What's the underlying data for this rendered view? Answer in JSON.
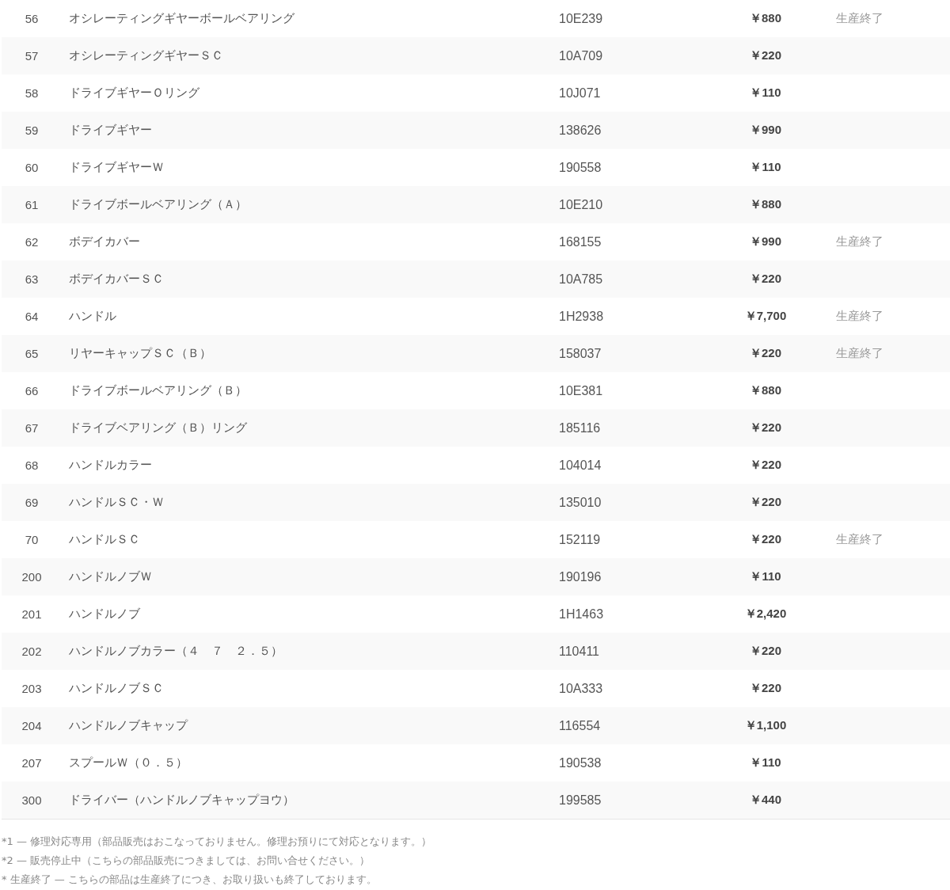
{
  "parts_table": {
    "rows": [
      {
        "no": "56",
        "name": "オシレーティングギヤーボールベアリング",
        "code": "10E239",
        "price": "￥880",
        "status": "生産終了"
      },
      {
        "no": "57",
        "name": "オシレーティングギヤーＳＣ",
        "code": "10A709",
        "price": "￥220"
      },
      {
        "no": "58",
        "name": "ドライブギヤーＯリング",
        "code": "10J071",
        "price": "￥110"
      },
      {
        "no": "59",
        "name": "ドライブギヤー",
        "code": "138626",
        "price": "￥990"
      },
      {
        "no": "60",
        "name": "ドライブギヤーＷ",
        "code": "190558",
        "price": "￥110"
      },
      {
        "no": "61",
        "name": "ドライブボールベアリング（Ａ）",
        "code": "10E210",
        "price": "￥880"
      },
      {
        "no": "62",
        "name": "ボデイカバー",
        "code": "168155",
        "price": "￥990",
        "status": "生産終了"
      },
      {
        "no": "63",
        "name": "ボデイカバーＳＣ",
        "code": "10A785",
        "price": "￥220"
      },
      {
        "no": "64",
        "name": "ハンドル",
        "code": "1H2938",
        "price": "￥7,700",
        "status": "生産終了"
      },
      {
        "no": "65",
        "name": "リヤーキャップＳＣ（Ｂ）",
        "code": "158037",
        "price": "￥220",
        "status": "生産終了"
      },
      {
        "no": "66",
        "name": "ドライブボールベアリング（Ｂ）",
        "code": "10E381",
        "price": "￥880"
      },
      {
        "no": "67",
        "name": "ドライブベアリング（Ｂ）リング",
        "code": "185116",
        "price": "￥220"
      },
      {
        "no": "68",
        "name": "ハンドルカラー",
        "code": "104014",
        "price": "￥220"
      },
      {
        "no": "69",
        "name": "ハンドルＳＣ・Ｗ",
        "code": "135010",
        "price": "￥220"
      },
      {
        "no": "70",
        "name": "ハンドルＳＣ",
        "code": "152119",
        "price": "￥220",
        "status": "生産終了"
      },
      {
        "no": "200",
        "name": "ハンドルノブＷ",
        "code": "190196",
        "price": "￥110"
      },
      {
        "no": "201",
        "name": "ハンドルノブ",
        "code": "1H1463",
        "price": "￥2,420"
      },
      {
        "no": "202",
        "name": "ハンドルノブカラー（４　７　２．５）",
        "code": "110411",
        "price": "￥220"
      },
      {
        "no": "203",
        "name": "ハンドルノブＳＣ",
        "code": "10A333",
        "price": "￥220"
      },
      {
        "no": "204",
        "name": "ハンドルノブキャップ",
        "code": "116554",
        "price": "￥1,100"
      },
      {
        "no": "207",
        "name": "スプールＷ（０．５）",
        "code": "190538",
        "price": "￥110"
      },
      {
        "no": "300",
        "name": "ドライバー（ハンドルノブキャップヨウ）",
        "code": "199585",
        "price": "￥440"
      }
    ]
  },
  "notes": [
    "*1 — 修理対応専用（部品販売はおこなっておりません。修理お預りにて対応となります。）",
    "*2 — 販売停止中（こちらの部品販売につきましては、お問い合せください。）",
    "* 生産終了 — こちらの部品は生産終了につき、お取り扱いも終了しております。"
  ]
}
